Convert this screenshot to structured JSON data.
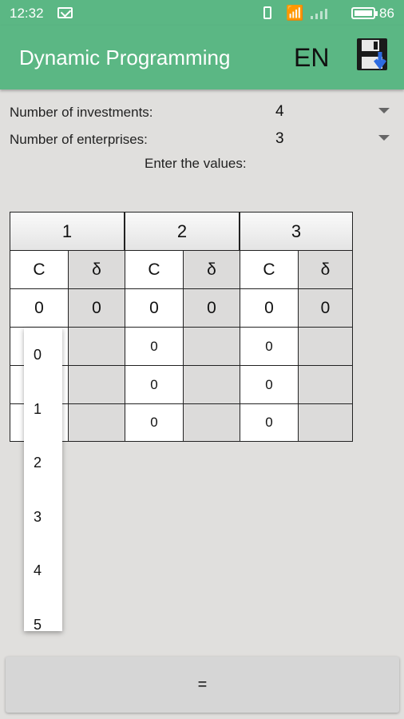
{
  "status_bar": {
    "time": "12:32",
    "battery_pct": "86"
  },
  "app_bar": {
    "title": "Dynamic Programming",
    "language": "EN",
    "icon": "save-icon"
  },
  "settings": {
    "investments_label": "Number of investments:",
    "investments_value": "4",
    "enterprises_label": "Number of enterprises:",
    "enterprises_value": "3"
  },
  "enter_values_label": "Enter the values:",
  "table": {
    "enterprises": [
      "1",
      "2",
      "3"
    ],
    "col_c": "C",
    "col_delta": "δ",
    "row0": [
      "0",
      "0",
      "0",
      "0",
      "0",
      "0"
    ],
    "rows": [
      [
        "",
        "",
        "0",
        "",
        "0",
        ""
      ],
      [
        "",
        "",
        "0",
        "",
        "0",
        ""
      ],
      [
        "",
        "",
        "0",
        "",
        "0",
        ""
      ]
    ]
  },
  "dropdown_options": [
    "0",
    "1",
    "2",
    "3",
    "4",
    "5"
  ],
  "equals_button": "="
}
